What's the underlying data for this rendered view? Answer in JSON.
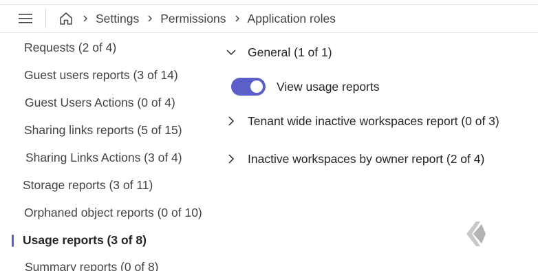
{
  "header": {
    "menu_icon": "hamburger-menu-icon",
    "home_icon": "home-icon",
    "breadcrumbs": [
      "Settings",
      "Permissions",
      "Application roles"
    ]
  },
  "sidebar": {
    "items": [
      {
        "label": "Requests (2 of 4)"
      },
      {
        "label": "Guest users reports (3 of 14)"
      },
      {
        "label": "Guest Users Actions (0 of 4)"
      },
      {
        "label": "Sharing links reports (5 of 15)"
      },
      {
        "label": "Sharing Links Actions (3 of 4)"
      },
      {
        "label": "Storage reports (3 of 11)"
      },
      {
        "label": "Orphaned object reports (0 of 10)"
      },
      {
        "label": "Usage reports (3 of 8)",
        "active": true
      },
      {
        "label": "Summary reports (0 of 8)"
      }
    ]
  },
  "main": {
    "groups": [
      {
        "label": "General (1 of 1)",
        "expanded": true
      },
      {
        "label": "Tenant wide inactive workspaces report (0 of 3)",
        "expanded": false
      },
      {
        "label": "Inactive workspaces by owner report (2 of 4)",
        "expanded": false
      }
    ],
    "toggle": {
      "label": "View usage reports",
      "on": true
    }
  },
  "colors": {
    "accent": "#5b5fc7",
    "text": "#242424",
    "muted": "#424242",
    "divider": "#e6e6e6"
  }
}
